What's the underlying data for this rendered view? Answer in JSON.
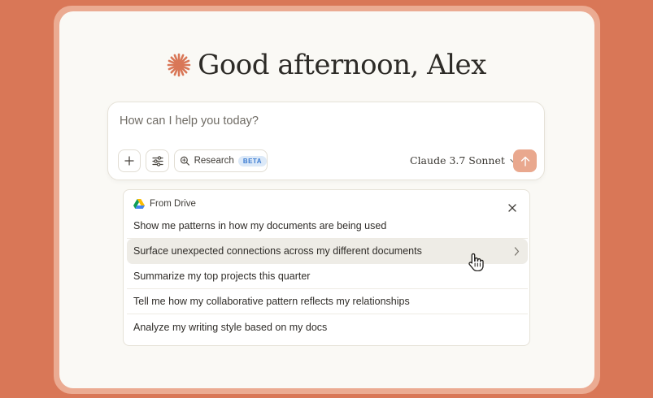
{
  "greeting": {
    "text": "Good afternoon, Alex"
  },
  "composer": {
    "placeholder": "How can I help you today?",
    "research_label": "Research",
    "beta_badge": "BETA",
    "model_name": "Claude 3.7 Sonnet"
  },
  "drive_panel": {
    "title": "From Drive",
    "suggestions": [
      {
        "label": "Show me patterns in how my documents are being used"
      },
      {
        "label": "Surface unexpected connections across my different documents"
      },
      {
        "label": "Summarize my top projects this quarter"
      },
      {
        "label": "Tell me how my collaborative pattern reflects my relationships"
      },
      {
        "label": "Analyze my writing style based on my docs"
      }
    ]
  },
  "colors": {
    "background": "#d97757",
    "accent": "#d97757",
    "send_button": "#e9a88e",
    "highlight_row": "#eeece6"
  },
  "icons": [
    "claude-spark-icon",
    "plus-icon",
    "sliders-icon",
    "search-icon",
    "chevron-down-icon",
    "arrow-up-icon",
    "google-drive-icon",
    "close-icon",
    "chevron-right-icon",
    "hand-pointer-icon"
  ]
}
